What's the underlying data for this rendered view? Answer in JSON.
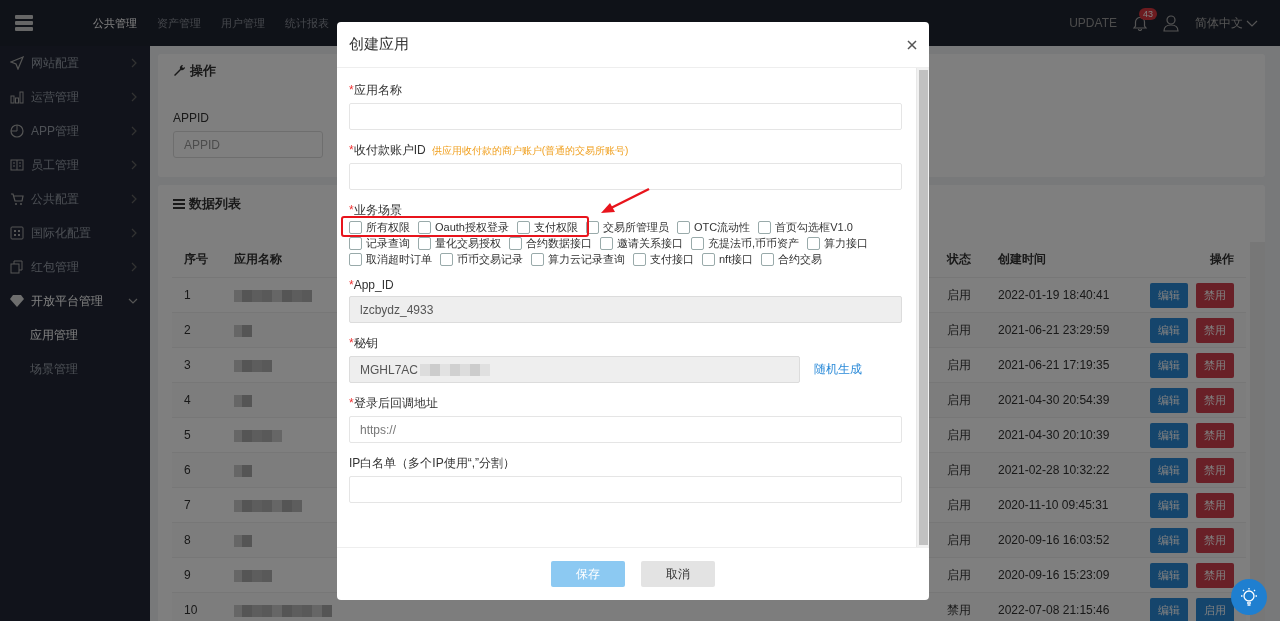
{
  "topbar": {
    "nav": [
      {
        "label": "公共管理",
        "selected": true
      },
      {
        "label": "资产管理",
        "selected": false
      },
      {
        "label": "用户管理",
        "selected": false
      },
      {
        "label": "统计报表",
        "selected": false
      }
    ],
    "update": "UPDATE",
    "notifications": "43",
    "language": "简体中文"
  },
  "sidebar": {
    "items": [
      {
        "label": "网站配置",
        "expanded": false
      },
      {
        "label": "运营管理",
        "expanded": false
      },
      {
        "label": "APP管理",
        "expanded": false
      },
      {
        "label": "员工管理",
        "expanded": false
      },
      {
        "label": "公共配置",
        "expanded": false
      },
      {
        "label": "国际化配置",
        "expanded": false
      },
      {
        "label": "红包管理",
        "expanded": false
      },
      {
        "label": "开放平台管理",
        "expanded": true,
        "children": [
          {
            "label": "应用管理",
            "selected": true
          },
          {
            "label": "场景管理",
            "selected": false
          }
        ]
      }
    ]
  },
  "filter_panel": {
    "title": "操作",
    "field_label": "APPID",
    "field_placeholder": "APPID"
  },
  "table_panel": {
    "title": "数据列表",
    "columns": [
      "序号",
      "应用名称",
      "状态",
      "创建时间",
      "操作"
    ],
    "rows": [
      {
        "index": "1",
        "status": "启用",
        "created": "2022-01-19 18:40:41",
        "actions": [
          {
            "label": "编辑",
            "kind": "edit"
          },
          {
            "label": "禁用",
            "kind": "disable"
          }
        ]
      },
      {
        "index": "2",
        "status": "启用",
        "created": "2021-06-21 23:29:59",
        "actions": [
          {
            "label": "编辑",
            "kind": "edit"
          },
          {
            "label": "禁用",
            "kind": "disable"
          }
        ]
      },
      {
        "index": "3",
        "status": "启用",
        "created": "2021-06-21 17:19:35",
        "actions": [
          {
            "label": "编辑",
            "kind": "edit"
          },
          {
            "label": "禁用",
            "kind": "disable"
          }
        ]
      },
      {
        "index": "4",
        "status": "启用",
        "created": "2021-04-30 20:54:39",
        "actions": [
          {
            "label": "编辑",
            "kind": "edit"
          },
          {
            "label": "禁用",
            "kind": "disable"
          }
        ]
      },
      {
        "index": "5",
        "status": "启用",
        "created": "2021-04-30 20:10:39",
        "actions": [
          {
            "label": "编辑",
            "kind": "edit"
          },
          {
            "label": "禁用",
            "kind": "disable"
          }
        ]
      },
      {
        "index": "6",
        "status": "启用",
        "created": "2021-02-28 10:32:22",
        "actions": [
          {
            "label": "编辑",
            "kind": "edit"
          },
          {
            "label": "禁用",
            "kind": "disable"
          }
        ]
      },
      {
        "index": "7",
        "status": "启用",
        "created": "2020-11-10 09:45:31",
        "actions": [
          {
            "label": "编辑",
            "kind": "edit"
          },
          {
            "label": "禁用",
            "kind": "disable"
          }
        ]
      },
      {
        "index": "8",
        "status": "启用",
        "created": "2020-09-16 16:03:52",
        "actions": [
          {
            "label": "编辑",
            "kind": "edit"
          },
          {
            "label": "禁用",
            "kind": "disable"
          }
        ]
      },
      {
        "index": "9",
        "status": "启用",
        "created": "2020-09-16 15:23:09",
        "actions": [
          {
            "label": "编辑",
            "kind": "edit"
          },
          {
            "label": "禁用",
            "kind": "disable"
          }
        ]
      },
      {
        "index": "10",
        "status": "禁用",
        "created": "2022-07-08 21:15:46",
        "actions": [
          {
            "label": "编辑",
            "kind": "edit"
          },
          {
            "label": "启用",
            "kind": "enable"
          }
        ]
      }
    ]
  },
  "modal": {
    "title": "创建应用",
    "fields": [
      {
        "kind": "text",
        "required_mark": "*",
        "label": "应用名称",
        "disabled": false
      },
      {
        "kind": "text",
        "required_mark": "*",
        "label": "收付款账户ID",
        "hint": "供应用收付款的商户账户(普通的交易所账号)",
        "disabled": false
      },
      {
        "kind": "checkboxes",
        "required_mark": "*",
        "label": "业务场景",
        "options": [
          {
            "label": "所有权限",
            "checked": false
          },
          {
            "label": "Oauth授权登录",
            "checked": false
          },
          {
            "label": "支付权限",
            "checked": false
          },
          {
            "label": "交易所管理员",
            "checked": false
          },
          {
            "label": "OTC流动性",
            "checked": false
          },
          {
            "label": "首页勾选框V1.0",
            "checked": false
          },
          {
            "label": "记录查询",
            "checked": false
          },
          {
            "label": "量化交易授权",
            "checked": false
          },
          {
            "label": "合约数据接口",
            "checked": false
          },
          {
            "label": "邀请关系接口",
            "checked": false
          },
          {
            "label": "充提法币,币币资产",
            "checked": false
          },
          {
            "label": "算力接口",
            "checked": false
          },
          {
            "label": "取消超时订单",
            "checked": false
          },
          {
            "label": "币币交易记录",
            "checked": false
          },
          {
            "label": "算力云记录查询",
            "checked": false
          },
          {
            "label": "支付接口",
            "checked": false
          },
          {
            "label": "nft接口",
            "checked": false
          },
          {
            "label": "合约交易",
            "checked": false
          }
        ]
      },
      {
        "kind": "text",
        "required_mark": "*",
        "label": "App_ID",
        "value": "lzcbydz_4933",
        "disabled": true
      },
      {
        "kind": "secret",
        "required_mark": "*",
        "label": "秘钥",
        "value": "MGHL7AC",
        "disabled": true,
        "link": "随机生成"
      },
      {
        "kind": "text",
        "required_mark": "*",
        "label": "登录后回调地址",
        "placeholder": "https://",
        "disabled": false
      },
      {
        "kind": "text",
        "label": "IP白名单（多个IP使用“,”分割）",
        "disabled": false
      }
    ],
    "buttons": [
      {
        "label": "保存",
        "kind": "primary"
      },
      {
        "label": "取消",
        "kind": "default"
      }
    ]
  }
}
